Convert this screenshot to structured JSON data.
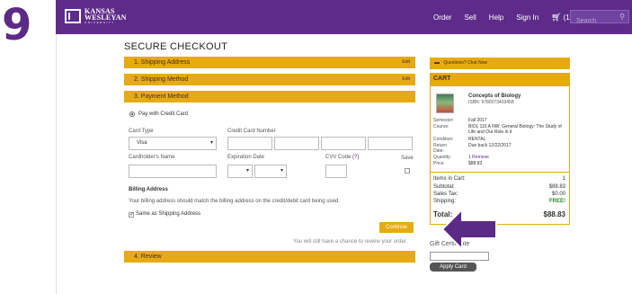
{
  "step_number": "9",
  "header": {
    "logo_line1": "KANSAS",
    "logo_line2": "WESLEYAN",
    "logo_sub": "UNIVERSITY",
    "nav": [
      "Order",
      "Sell",
      "Help",
      "Sign In"
    ],
    "cart_label": "(1)",
    "search_placeholder": "Search"
  },
  "page_title": "SECURE CHECKOUT",
  "steps": {
    "shipping_address": "1. Shipping Address",
    "shipping_method": "2. Shipping Method",
    "payment_method": "3. Payment Method",
    "review": "4. Review",
    "edit_label": "Edit"
  },
  "payment": {
    "pay_option": "Pay with Credit Card",
    "card_type_label": "Card Type",
    "card_type_value": "Visa",
    "card_number_label": "Credit Card Number",
    "cardholder_label": "Cardholder's Name",
    "expiration_label": "Expiration Date",
    "cvv_label": "CVV Code",
    "cvv_help": "(?)",
    "save_label": "Save",
    "billing_heading": "Billing Address",
    "billing_note": "Your billing address should match the billing address on the credit/debit card being used.",
    "same_as_shipping": "Same as Shipping Address",
    "continue_label": "Continue",
    "review_note": "You will still have a chance to review your order."
  },
  "sidebar": {
    "chat_label": "Questions? Chat Now",
    "cart_heading": "CART",
    "book_title": "Concepts of Biology",
    "book_isbn": "ISBN: 9780073403458",
    "details": [
      {
        "label": "Semester:",
        "value": "Fall 2017"
      },
      {
        "label": "Course:",
        "value": "BIOL 110 A NW: General Biology: The Study of Life and Our Role in it"
      },
      {
        "label": "Condition:",
        "value": "RENTAL"
      },
      {
        "label": "Return Date:",
        "value": "Due back 12/22/2017"
      },
      {
        "label": "Quantity:",
        "value": "1"
      },
      {
        "label": "Price:",
        "value": "$88.83"
      }
    ],
    "remove_label": "Remove",
    "totals": [
      {
        "label": "Items in Cart:",
        "value": "1"
      },
      {
        "label": "Subtotal:",
        "value": "$88.83"
      },
      {
        "label": "Sales Tax:",
        "value": "$0.00"
      },
      {
        "label": "Shipping:",
        "value": "FREE!"
      }
    ],
    "total_label": "Total:",
    "total_value": "$88.83",
    "gift_certificate_label": "Gift Certificate",
    "apply_card_label": "Apply Card"
  },
  "colors": {
    "brand_purple": "#5e2b8a",
    "accent_gold": "#e6aa14",
    "arrow_purple": "#5b2a86"
  }
}
